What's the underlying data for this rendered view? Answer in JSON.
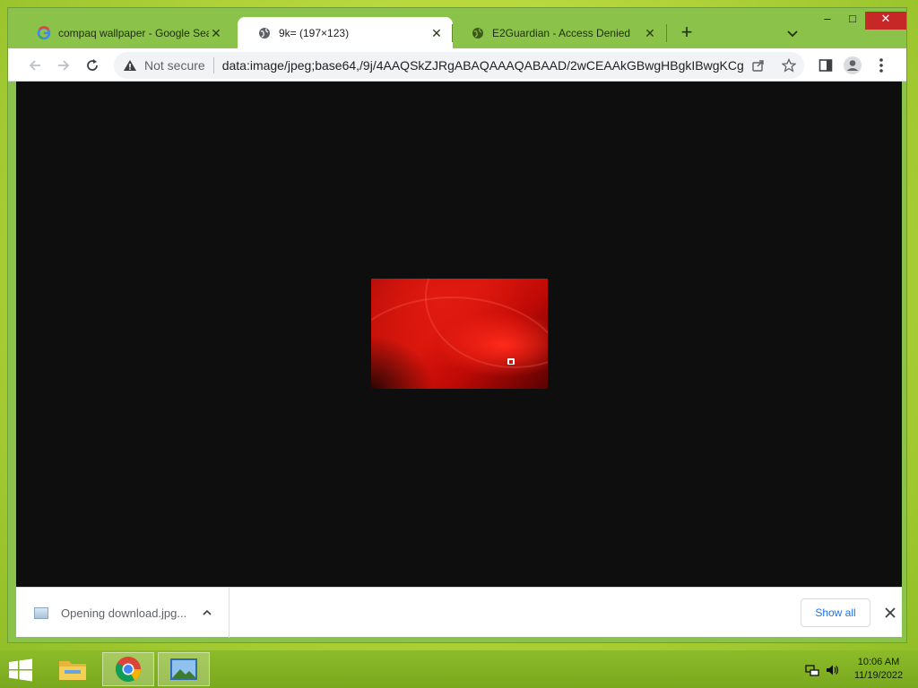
{
  "browser": {
    "tabs": [
      {
        "title": "compaq wallpaper - Google Sea",
        "favicon": "google-g-icon",
        "active": false
      },
      {
        "title": "9k= (197×123)",
        "favicon": "globe-icon",
        "active": true
      },
      {
        "title": "E2Guardian - Access Denied",
        "favicon": "globe-icon",
        "active": false
      }
    ],
    "new_tab_label": "+",
    "window_controls": {
      "minimize": "–",
      "maximize": "□",
      "close": "✕"
    }
  },
  "toolbar": {
    "security_label": "Not secure",
    "url": "data:image/jpeg;base64,/9j/4AAQSkZJRgABAQAAAQABAAD/2wCEAAkGBwgHBgkIBwgKCgkL..."
  },
  "downloads": {
    "item_label": "Opening download.jpg...",
    "show_all_label": "Show all"
  },
  "taskbar": {
    "time": "10:06 AM",
    "date": "11/19/2022"
  },
  "colors": {
    "accent": "#8bc34a",
    "viewport_bg": "#0e0e0e",
    "link_blue": "#1a73e8"
  }
}
